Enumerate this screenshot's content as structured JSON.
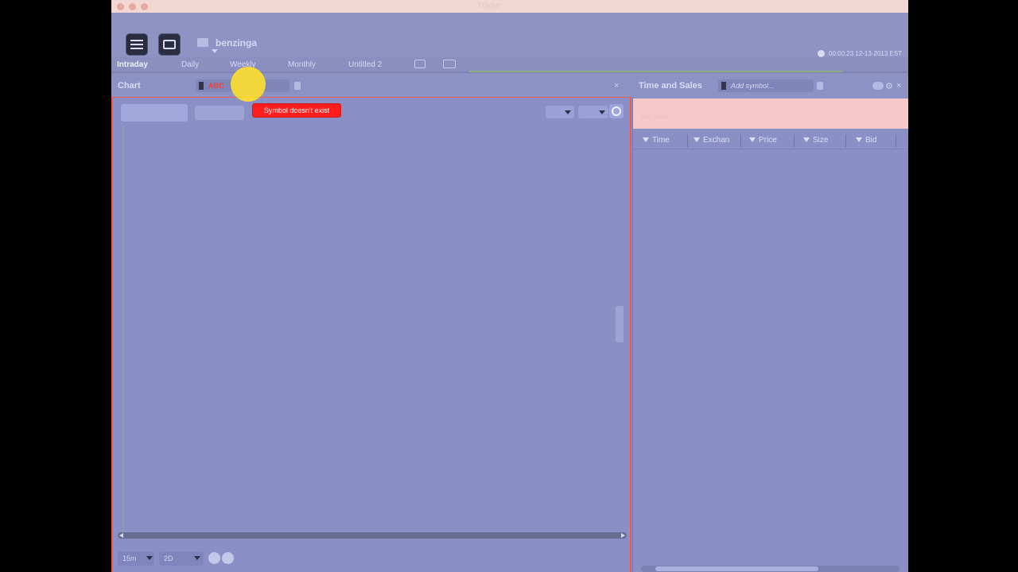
{
  "window": {
    "title": "Trader"
  },
  "header": {
    "account_name": "benzinga",
    "clock": "00:00:23 12-13-2013 EST"
  },
  "tabs": [
    {
      "label": "Intraday",
      "active": true
    },
    {
      "label": "Daily",
      "active": false
    },
    {
      "label": "Weekly",
      "active": false
    },
    {
      "label": "Monthly",
      "active": false
    },
    {
      "label": "Untitled 2",
      "active": false
    }
  ],
  "chart": {
    "title": "Chart",
    "symbol_value": "ABC",
    "error_message": "Symbol doesn't exist",
    "interval": "15m",
    "range": "2D"
  },
  "time_and_sales": {
    "title": "Time and Sales",
    "symbol_placeholder": "Add symbol...",
    "banner_text": "No data",
    "columns": [
      "Time",
      "Exchan",
      "Price",
      "Size",
      "Bid"
    ]
  },
  "icons": {
    "menu": "menu-icon",
    "monitor": "monitor-icon",
    "account": "briefcase-icon",
    "clock": "clock-icon",
    "lock": "lock-icon",
    "settings": "gear-icon"
  },
  "colors": {
    "accent_border": "#f35c4c",
    "error": "#ff1d1d",
    "cursor_highlight": "#ffe02c"
  }
}
